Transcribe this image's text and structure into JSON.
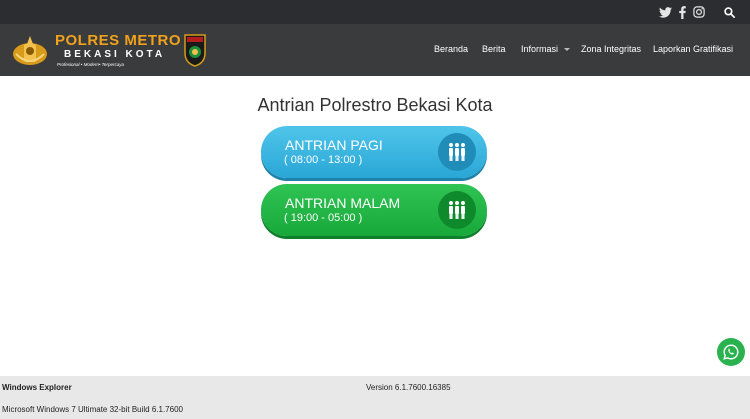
{
  "brand": {
    "title": "POLRES METRO",
    "subtitle": "BEKASI KOTA",
    "tagline": "Profesional  •  Modern•  Terpercaya"
  },
  "social": [
    "twitter-icon",
    "facebook-icon",
    "instagram-icon",
    "search-icon"
  ],
  "nav": {
    "items": [
      "Beranda",
      "Berita",
      "Informasi",
      "Zona Integritas",
      "Laporkan Gratifikasi"
    ]
  },
  "main": {
    "title": "Antrian Polrestro Bekasi Kota",
    "queues": [
      {
        "label": "ANTRIAN PAGI",
        "hours": "( 08:00 - 13:00 )",
        "color": "#2aa6d6"
      },
      {
        "label": "ANTRIAN MALAM",
        "hours": "( 19:00 - 05:00 )",
        "color": "#18a83a"
      }
    ]
  },
  "footer": {
    "app_name": "Windows Explorer",
    "version": "Version 6.1.7600.16385",
    "os": "Microsoft Windows 7 Ultimate  32-bit Build 6.1.7600"
  },
  "colors": {
    "accent": "#f0a21c",
    "topbar": "#2b2d30",
    "navbar": "#3a3b3d",
    "whatsapp": "#2ab24e"
  }
}
